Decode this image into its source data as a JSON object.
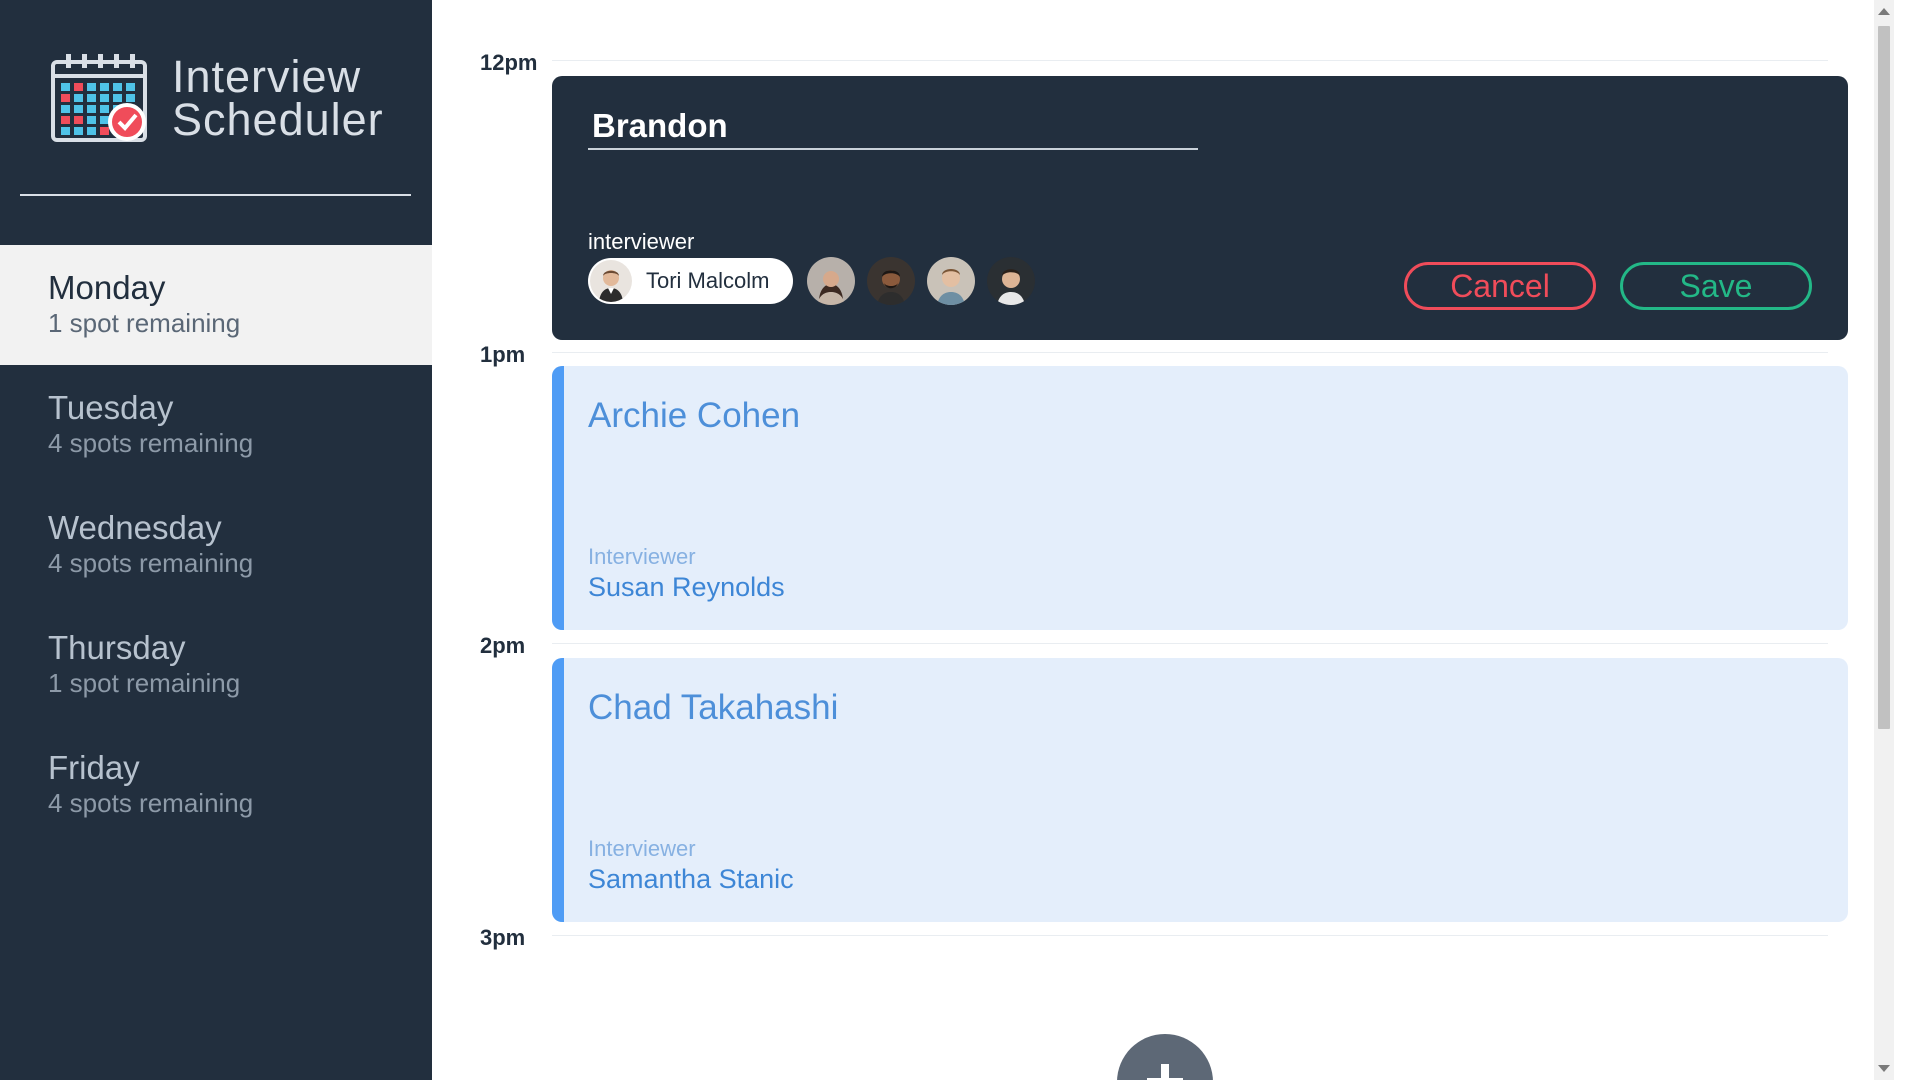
{
  "brand": {
    "title_line1": "Interview",
    "title_line2": "Scheduler",
    "logo_icon": "calendar-check-icon"
  },
  "days": [
    {
      "name": "Monday",
      "spots": "1 spot remaining",
      "selected": true
    },
    {
      "name": "Tuesday",
      "spots": "4 spots remaining",
      "selected": false
    },
    {
      "name": "Wednesday",
      "spots": "4 spots remaining",
      "selected": false
    },
    {
      "name": "Thursday",
      "spots": "1 spot remaining",
      "selected": false
    },
    {
      "name": "Friday",
      "spots": "4 spots remaining",
      "selected": false
    }
  ],
  "hours": [
    "12pm",
    "1pm",
    "2pm",
    "3pm"
  ],
  "form": {
    "student_name": "Brandon",
    "interviewer_label": "interviewer",
    "selected_interviewer": "Tori Malcolm",
    "other_interviewer_avatars": 4,
    "cancel_label": "Cancel",
    "save_label": "Save"
  },
  "appointments": [
    {
      "student": "Archie Cohen",
      "interviewer_label": "Interviewer",
      "interviewer": "Susan Reynolds"
    },
    {
      "student": "Chad Takahashi",
      "interviewer_label": "Interviewer",
      "interviewer": "Samantha Stanic"
    }
  ],
  "add_button_icon": "plus-icon",
  "colors": {
    "sidebar_bg": "#222f3e",
    "cancel": "#f04c5a",
    "save": "#23b887",
    "appointment_bg": "#e4eefb",
    "appointment_accent": "#4f9cf5"
  }
}
